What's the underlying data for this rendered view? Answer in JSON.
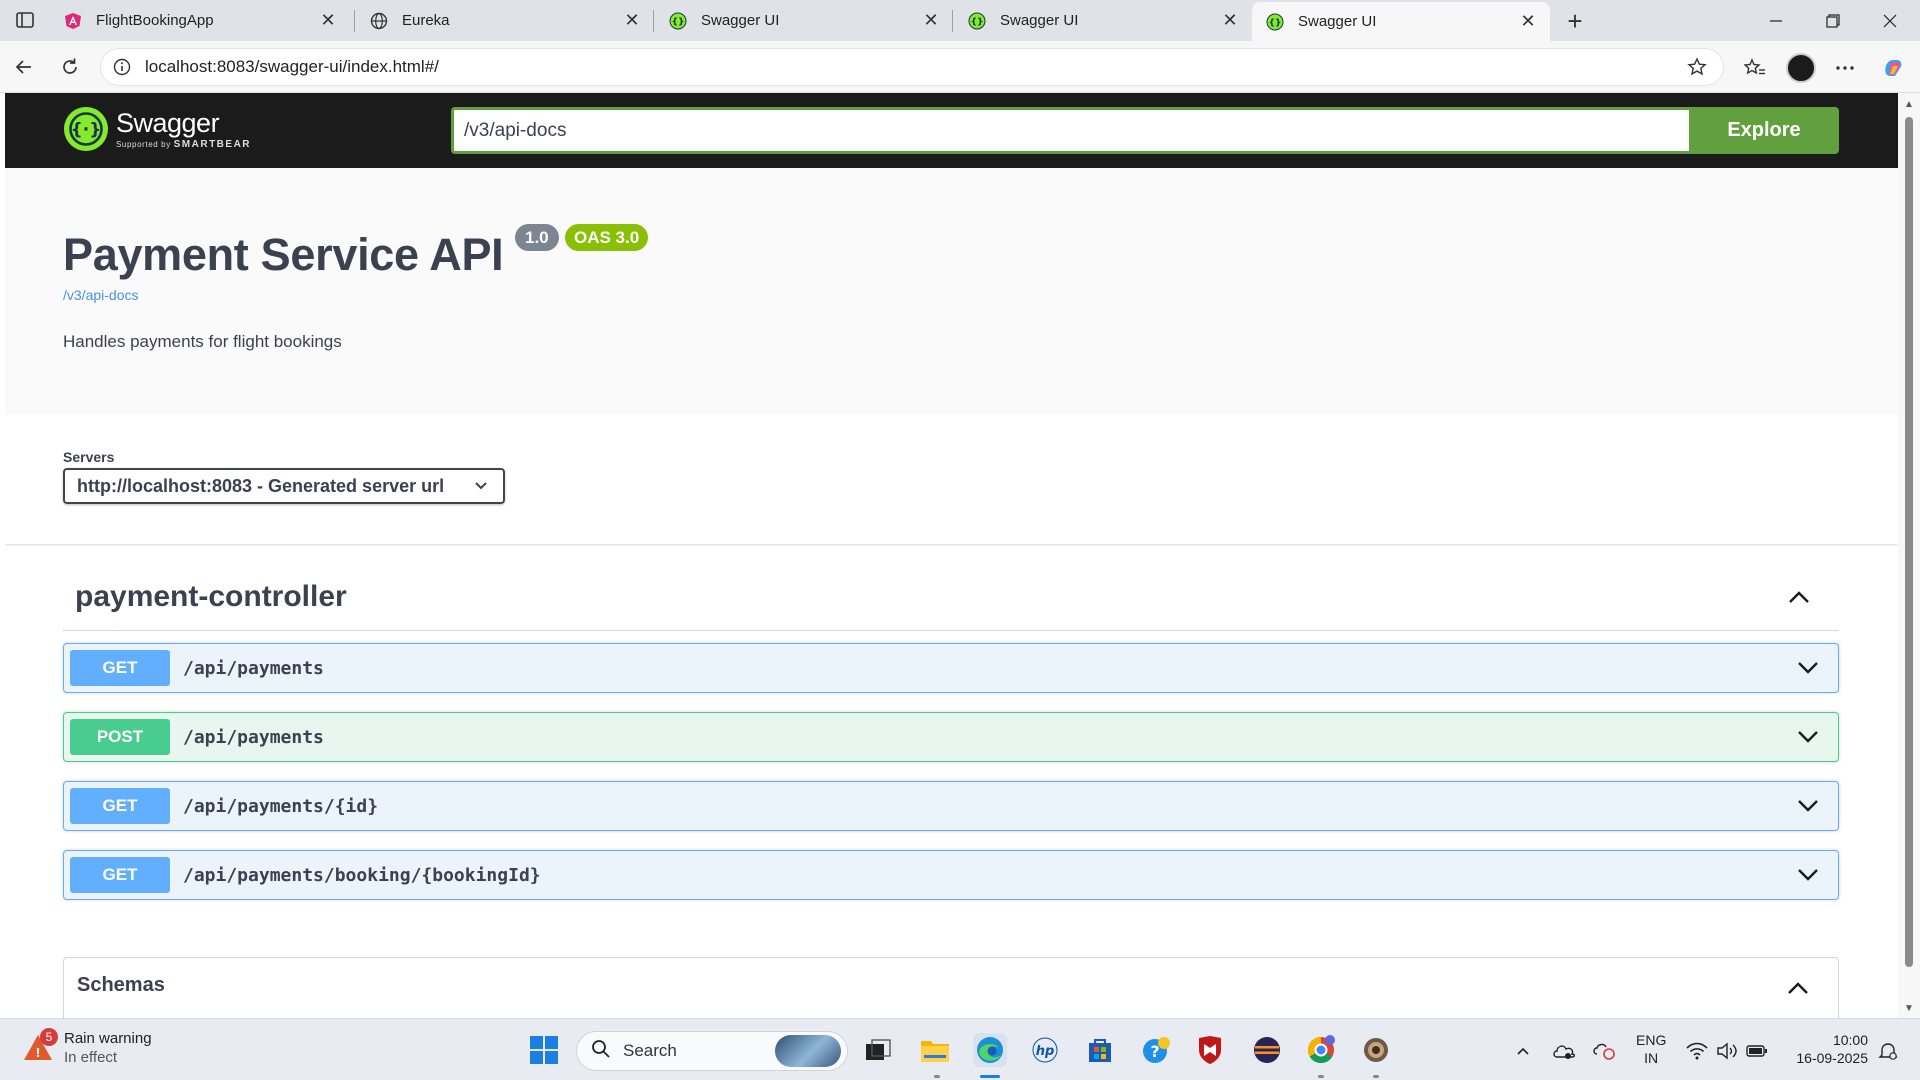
{
  "browser": {
    "tabs": [
      {
        "title": "FlightBookingApp",
        "icon": "angular-icon"
      },
      {
        "title": "Eureka",
        "icon": "globe-icon"
      },
      {
        "title": "Swagger UI",
        "icon": "swagger-icon"
      },
      {
        "title": "Swagger UI",
        "icon": "swagger-icon"
      },
      {
        "title": "Swagger UI",
        "icon": "swagger-icon",
        "active": true
      }
    ],
    "address": "localhost:8083/swagger-ui/index.html#/"
  },
  "swagger": {
    "logo_name": "Swagger",
    "logo_sub_prefix": "Supported by",
    "logo_sub_brand": "SMARTBEAR",
    "spec_url": "/v3/api-docs",
    "explore_label": "Explore",
    "title": "Payment Service API",
    "version": "1.0",
    "oas": "OAS 3.0",
    "spec_link": "/v3/api-docs",
    "description": "Handles payments for flight bookings",
    "servers_label": "Servers",
    "server_selected": "http://localhost:8083 - Generated server url",
    "controller": "payment-controller",
    "operations": [
      {
        "method": "GET",
        "path": "/api/payments"
      },
      {
        "method": "POST",
        "path": "/api/payments"
      },
      {
        "method": "GET",
        "path": "/api/payments/{id}"
      },
      {
        "method": "GET",
        "path": "/api/payments/booking/{bookingId}"
      }
    ],
    "schemas_label": "Schemas"
  },
  "taskbar": {
    "weather_count": "5",
    "weather_title": "Rain warning",
    "weather_sub": "In effect",
    "search_label": "Search",
    "lang_1": "ENG",
    "lang_2": "IN",
    "time": "10:00",
    "date": "16-09-2025"
  },
  "colors": {
    "get": "#61affe",
    "post": "#49cc90",
    "explore": "#62a03f",
    "topbar": "#1b1b1b"
  }
}
